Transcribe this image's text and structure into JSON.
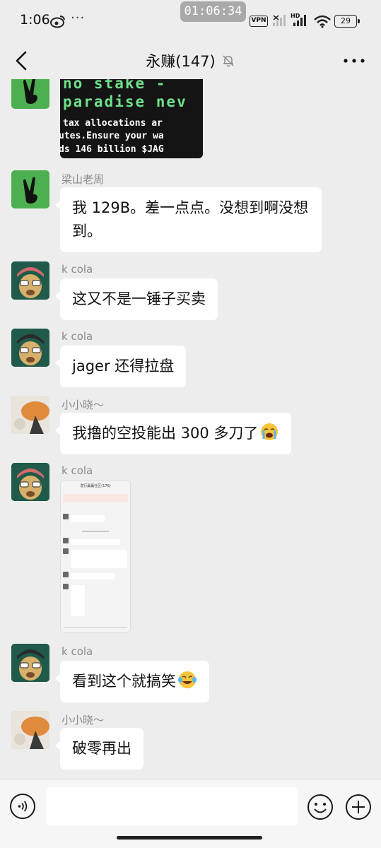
{
  "status_bar": {
    "time": "1:06",
    "extra": "···",
    "recording_time": "01:06:34",
    "vpn": "VPN",
    "hd": "HD",
    "battery": "29"
  },
  "header": {
    "title": "永赚(147)"
  },
  "image_message": {
    "line1": "no stake -",
    "line2": "paradise nev",
    "line3": "tax allocations ar",
    "line4": "utes.Ensure your wa",
    "line5": "ds 146 billion $JAG"
  },
  "messages": [
    {
      "sender": "梁山老周",
      "text": "我 129B。差一点点。没想到啊没想到。",
      "avatar": "victory-hand-avatar"
    },
    {
      "sender": "k cola",
      "text": "这又不是一锤子买卖",
      "avatar": "cartoon-avatar"
    },
    {
      "sender": "k cola",
      "text": "jager 还得拉盘",
      "avatar": "cartoon-avatar"
    },
    {
      "sender": "小小晓～",
      "text": "我撸的空投能出 300 多刀了",
      "avatar": "cat-avatar",
      "emoji": "loudly-crying-emoji"
    },
    {
      "sender": "k cola",
      "avatar": "cartoon-avatar",
      "image": "chat-screenshot"
    },
    {
      "sender": "k cola",
      "text": "看到这个就搞笑",
      "avatar": "cartoon-avatar",
      "emoji": "tears-of-joy-emoji"
    },
    {
      "sender": "小小晓～",
      "text": "破零再出",
      "avatar": "cat-avatar"
    }
  ],
  "screenshot_thumb": {
    "title": "龙行赢赢社区(176)"
  },
  "input_bar": {
    "placeholder": ""
  },
  "colors": {
    "background": "#ededed",
    "bubble": "#ffffff",
    "avatar_green": "#4caf50"
  }
}
